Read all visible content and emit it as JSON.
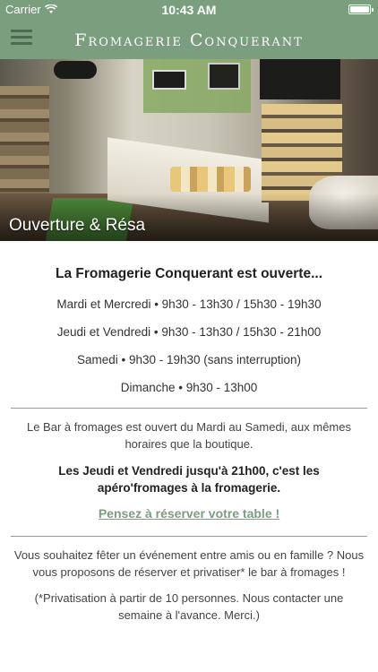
{
  "status_bar": {
    "carrier": "Carrier",
    "time": "10:43 AM"
  },
  "nav": {
    "title": "Fromagerie Conquerant",
    "menu_icon": "hamburger-menu-icon"
  },
  "hero": {
    "caption": "Ouverture & Résa"
  },
  "hours": {
    "headline": "La Fromagerie Conquerant est ouverte...",
    "rows": [
      "Mardi et Mercredi • 9h30 - 13h30 / 15h30 - 19h30",
      "Jeudi et Vendredi • 9h30 - 13h30 / 15h30 - 21h00",
      "Samedi • 9h30 - 19h30 (sans interruption)",
      "Dimanche • 9h30 - 13h00"
    ]
  },
  "bar": {
    "info": "Le Bar à fromages est ouvert du Mardi au Samedi, aux mêmes horaires que la boutique.",
    "apero": "Les Jeudi et Vendredi jusqu'à 21h00, c'est les apéro'fromages à la fromagerie.",
    "reserve_link": "Pensez à réserver votre table !"
  },
  "event": {
    "text": "Vous souhaitez fêter un événement entre amis ou en famille ? Nous vous proposons de réserver et privatiser* le bar à fromages !",
    "note": "(*Privatisation à partir de 10 personnes. Nous contacter une semaine à l'avance. Merci.)"
  },
  "colors": {
    "brand_green": "#7a9e7e",
    "menu_icon_green": "#4e6b52"
  }
}
